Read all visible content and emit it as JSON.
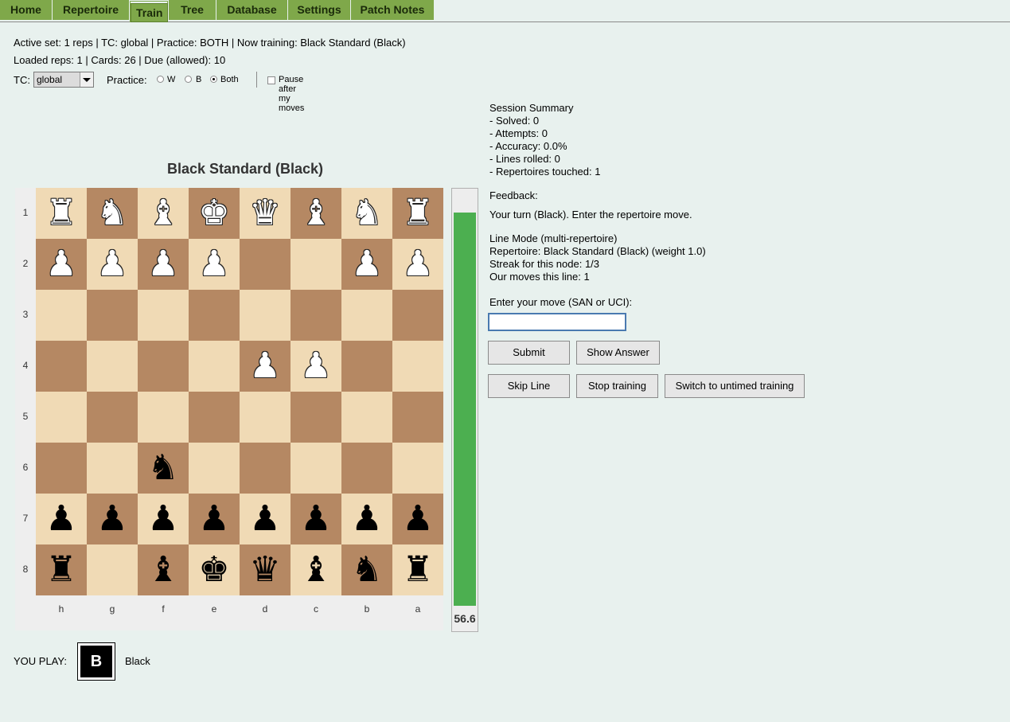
{
  "nav": {
    "tabs": [
      {
        "label": "Home"
      },
      {
        "label": "Repertoire"
      },
      {
        "label": "Train",
        "active": true
      },
      {
        "label": "Tree"
      },
      {
        "label": "Database"
      },
      {
        "label": "Settings"
      },
      {
        "label": "Patch Notes"
      }
    ]
  },
  "status": {
    "line1": "Active set: 1 reps | TC: global | Practice: BOTH | Now training: Black Standard (Black)",
    "line2": "Loaded reps: 1 | Cards: 26 | Due (allowed): 10"
  },
  "controls": {
    "tc_label": "TC:",
    "tc_value": "global",
    "practice_label": "Practice:",
    "practice_options": [
      "W",
      "B",
      "Both"
    ],
    "practice_selected": "Both",
    "pause_label": "Pause after my moves",
    "pause_checked": false
  },
  "board": {
    "title": "Black Standard (Black)",
    "ranks": [
      "1",
      "2",
      "3",
      "4",
      "5",
      "6",
      "7",
      "8"
    ],
    "files": [
      "h",
      "g",
      "f",
      "e",
      "d",
      "c",
      "b",
      "a"
    ],
    "rows": [
      [
        "wR",
        "wN",
        "wB",
        "wK",
        "wQ",
        "wB",
        "wN",
        "wR"
      ],
      [
        "wP",
        "wP",
        "wP",
        "wP",
        "",
        "",
        "wP",
        "wP"
      ],
      [
        "",
        "",
        "",
        "",
        "",
        "",
        "",
        ""
      ],
      [
        "",
        "",
        "",
        "",
        "wP",
        "wP",
        "",
        ""
      ],
      [
        "",
        "",
        "",
        "",
        "",
        "",
        "",
        ""
      ],
      [
        "",
        "",
        "bN",
        "",
        "",
        "",
        "",
        ""
      ],
      [
        "bP",
        "bP",
        "bP",
        "bP",
        "bP",
        "bP",
        "bP",
        "bP"
      ],
      [
        "bR",
        "",
        "bB",
        "bK",
        "bQ",
        "bB",
        "bN",
        "bR"
      ]
    ],
    "colors": {
      "light": "#f0dab5",
      "dark": "#b58863"
    }
  },
  "eval": {
    "value": "56.6",
    "fill_fraction": 0.566,
    "color": "#4caf50"
  },
  "summary": {
    "title": "Session Summary",
    "lines": [
      "- Solved: 0",
      "- Attempts: 0",
      "- Accuracy: 0.0%",
      "- Lines rolled: 0",
      "- Repertoires touched: 1"
    ]
  },
  "feedback": {
    "label": "Feedback:",
    "message": "Your turn (Black). Enter the repertoire move.",
    "lines": [
      "Line Mode (multi-repertoire)",
      "Repertoire: Black Standard (Black) (weight 1.0)",
      "Streak for this node: 1/3",
      "Our moves this line: 1"
    ]
  },
  "move_entry": {
    "label": "Enter your move (SAN or UCI):",
    "value": ""
  },
  "buttons": {
    "submit": "Submit",
    "show_answer": "Show Answer",
    "skip_line": "Skip Line",
    "stop_training": "Stop training",
    "switch_untimed": "Switch to untimed training"
  },
  "you_play": {
    "label": "YOU PLAY:",
    "badge": "B",
    "side": "Black"
  }
}
